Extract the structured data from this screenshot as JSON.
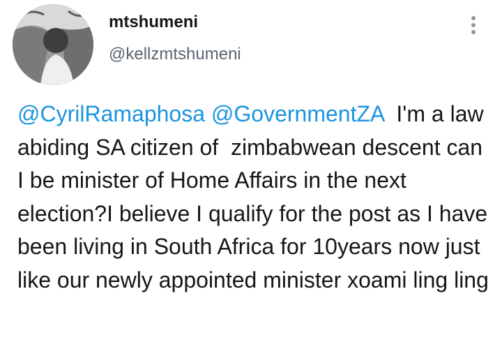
{
  "user": {
    "display_name": "mtshumeni",
    "handle": "@kellzmtshumeni",
    "avatar_icon": "profile-photo"
  },
  "menu": {
    "icon": "more-vertical-icon"
  },
  "tweet": {
    "mentions": [
      "@CyrilRamaphosa",
      "@GovernmentZA"
    ],
    "text": "  I'm a law abiding SA citizen of  zimbabwean descent can I be minister of Home Affairs in the next election?I believe I qualify for the post as I have been living in South Africa for 10years now just like our newly appointed minister xoami ling ling"
  },
  "colors": {
    "text": "#14171a",
    "mention": "#1b95e0",
    "handle": "#5b6570"
  }
}
